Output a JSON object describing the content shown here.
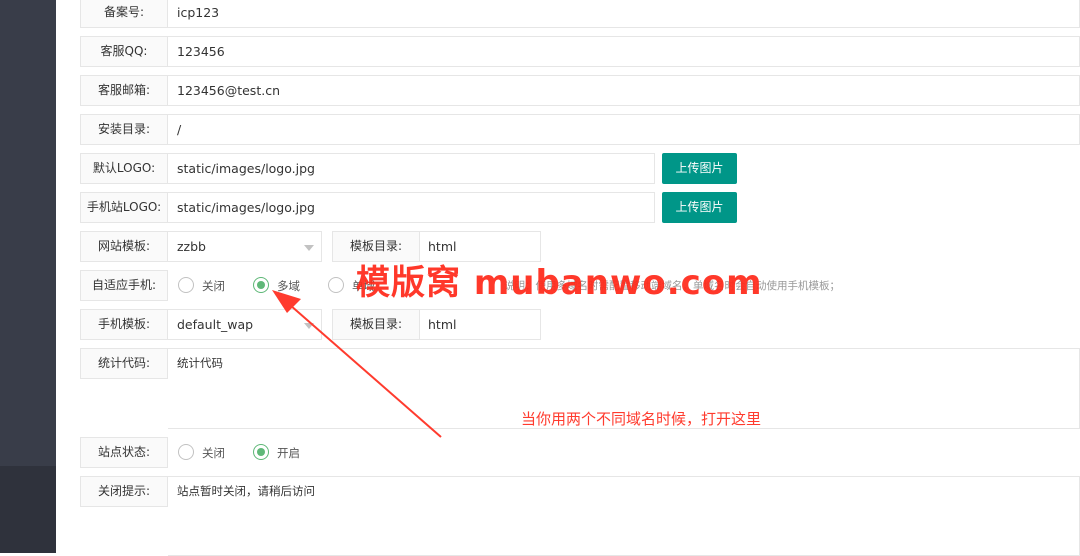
{
  "form": {
    "icp": {
      "label": "备案号:",
      "value": "icp123"
    },
    "qq": {
      "label": "客服QQ:",
      "value": "123456"
    },
    "email": {
      "label": "客服邮箱:",
      "value": "123456@test.cn"
    },
    "install_dir": {
      "label": "安装目录:",
      "value": "/"
    },
    "logo": {
      "label": "默认LOGO:",
      "value": "static/images/logo.jpg",
      "button": "上传图片"
    },
    "mobile_logo": {
      "label": "手机站LOGO:",
      "value": "static/images/logo.jpg",
      "button": "上传图片"
    },
    "site_template": {
      "label": "网站模板:",
      "value": "zzbb",
      "dir_label": "模板目录:",
      "dir_value": "html"
    },
    "adaptive": {
      "label": "自适应手机:",
      "options": [
        "关闭",
        "多域",
        "单域"
      ],
      "selected": "多域",
      "hint": "说明：使用多域名时需配置移动端域名，单域名时会自动使用手机模板；"
    },
    "mobile_template": {
      "label": "手机模板:",
      "value": "default_wap",
      "dir_label": "模板目录:",
      "dir_value": "html"
    },
    "stats_code": {
      "label": "统计代码:",
      "value": "统计代码"
    },
    "site_status": {
      "label": "站点状态:",
      "options": [
        "关闭",
        "开启"
      ],
      "selected": "开启"
    },
    "close_notice": {
      "label": "关闭提示:",
      "value": "站点暂时关闭，请稍后访问"
    }
  },
  "overlay": {
    "watermark": "模版窝 mubanwo.com",
    "annotation": "当你用两个不同域名时候，打开这里"
  },
  "colors": {
    "primary": "#009688",
    "radio": "#5fb878",
    "annotation": "#ff3b2e",
    "sidebar": "#393d49"
  }
}
